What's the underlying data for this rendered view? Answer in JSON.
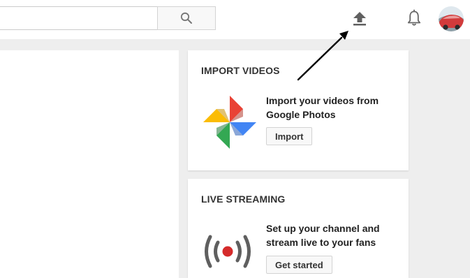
{
  "search": {
    "value": "",
    "placeholder": ""
  },
  "header": {
    "icons": [
      "search-icon",
      "upload-icon",
      "bell-icon"
    ],
    "avatar_color": "#d23b3b"
  },
  "cards": {
    "import": {
      "title": "IMPORT VIDEOS",
      "description": "Import your videos from Google Photos",
      "button": "Import",
      "icon": "google-photos-icon"
    },
    "live": {
      "title": "LIVE STREAMING",
      "description": "Set up your channel and stream live to your fans",
      "button": "Get started",
      "icon": "live-broadcast-icon",
      "accent": "#d52b2b"
    }
  },
  "annotation": {
    "icon": "pointer-arrow",
    "color": "#000000"
  }
}
